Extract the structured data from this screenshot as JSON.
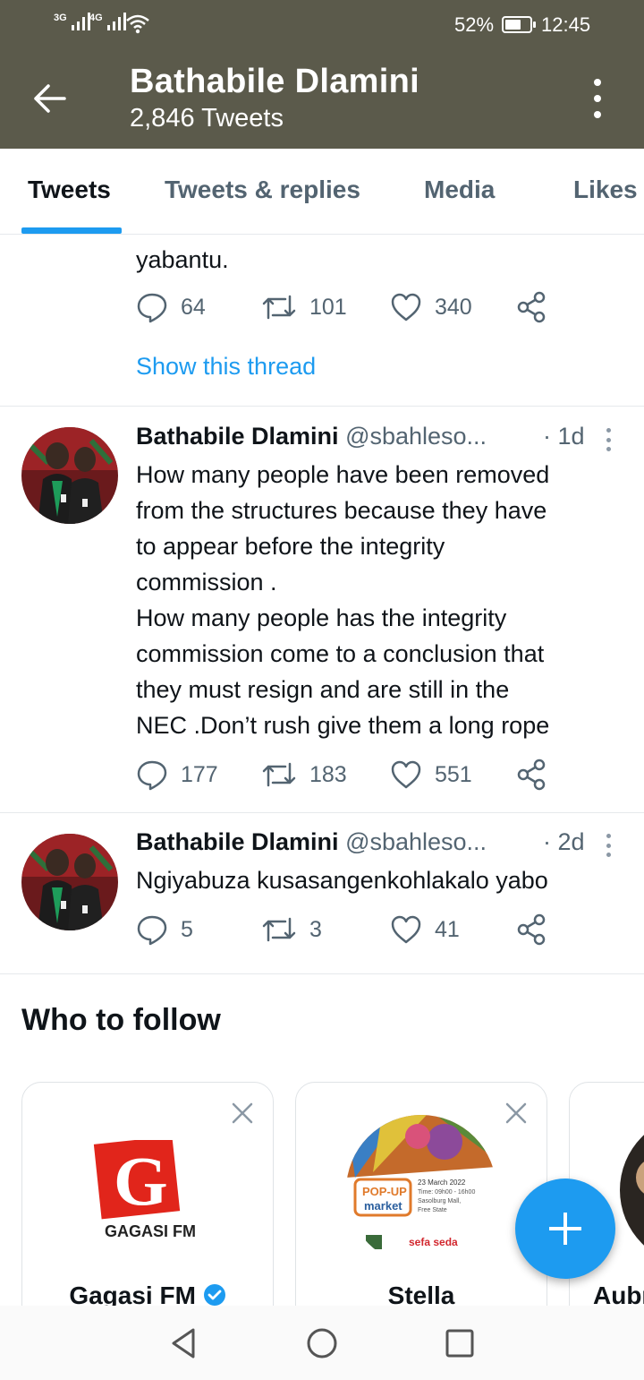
{
  "status_bar": {
    "signal_1": "3G",
    "signal_2": "4G",
    "battery": "52%",
    "time": "12:45"
  },
  "header": {
    "title": "Bathabile Dlamini",
    "subtitle": "2,846 Tweets"
  },
  "tabs": [
    "Tweets",
    "Tweets & replies",
    "Media",
    "Likes"
  ],
  "active_tab": "Tweets",
  "thread_tail": {
    "text": "yabantu.",
    "replies": "64",
    "retweets": "101",
    "likes": "340",
    "show_thread": "Show this thread"
  },
  "tweets": [
    {
      "name": "Bathabile Dlamini",
      "handle": "@sbahleso...",
      "time": "· 1d",
      "lines": [
        "How many people have been removed",
        "from the structures because they have",
        "to appear before the integrity",
        "commission .",
        "How many people has the integrity",
        "commission come to a conclusion that",
        "they must resign and are still in the",
        "NEC .Don’t rush give them a long rope"
      ],
      "replies": "177",
      "retweets": "183",
      "likes": "551"
    },
    {
      "name": "Bathabile Dlamini",
      "handle": "@sbahleso...",
      "time": "· 2d",
      "lines": [
        "Ngiyabuza kusasangenkohlakalo yabo"
      ],
      "replies": "5",
      "retweets": "3",
      "likes": "41"
    }
  ],
  "who_to_follow": {
    "title": "Who to follow",
    "cards": [
      {
        "name": "Gagasi FM",
        "verified": true,
        "logo_text": "GAGASI FM",
        "logo_letter": "G"
      },
      {
        "name": "Stella",
        "verified": false,
        "logo_lines": [
          "23 March 2022",
          "Time: 09h00 - 16h00",
          "Sasolburg Mall,",
          "Free State"
        ],
        "badge_top": "POP-UP",
        "badge_bottom": "market",
        "footer": "sefa seda"
      },
      {
        "name": "Aubr",
        "verified": false
      }
    ]
  },
  "icons": [
    "back-arrow-icon",
    "more-vertical-icon",
    "reply-icon",
    "retweet-icon",
    "like-icon",
    "share-icon",
    "close-icon",
    "verified-icon",
    "compose-icon",
    "nav-back-icon",
    "nav-home-icon",
    "nav-recents-icon"
  ],
  "colors": {
    "header_bg": "#5b5a4b",
    "accent": "#1d9bf0",
    "secondary_text": "#536471"
  }
}
